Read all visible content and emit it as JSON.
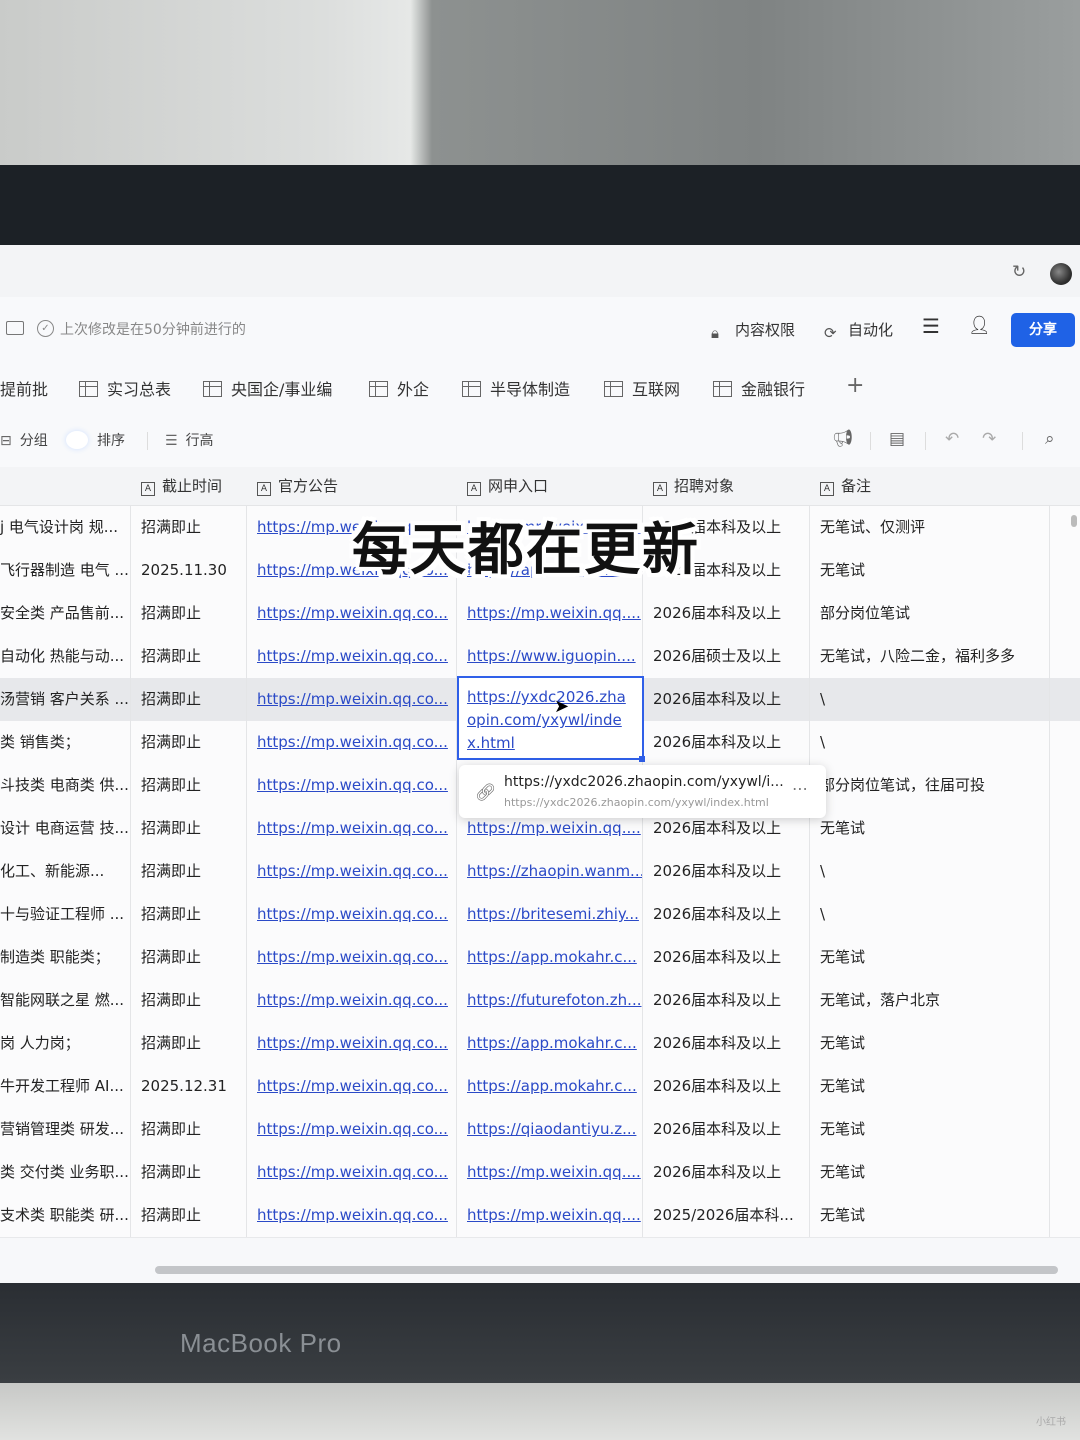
{
  "caption": "每天都在更新",
  "device_label": "MacBook Pro",
  "watermark": "小红书",
  "doc": {
    "status": "上次修改是在50分钟前进行的",
    "buttons": {
      "permissions": "内容权限",
      "automation": "自动化",
      "share": "分享"
    }
  },
  "tabs": [
    "提前批",
    "实习总表",
    "央国企/事业编",
    "外企",
    "半导体制造",
    "互联网",
    "金融银行"
  ],
  "toolbar": {
    "group": "分组",
    "sort": "排序",
    "row_height": "行高"
  },
  "columns": [
    "截止时间",
    "官方公告",
    "网申入口",
    "招聘对象",
    "备注"
  ],
  "rows": [
    {
      "c0": "j 电气设计岗 规...",
      "c1": "招满即止",
      "c2": "https://mp.weixin.qq.co...",
      "c3": "https://mp.weixin.qq....",
      "c4": "2026届本科及以上",
      "c5": "无笔试、仅测评"
    },
    {
      "c0": "飞行器制造 电气 ...",
      "c1": "2025.11.30",
      "c2": "https://mp.weixin.qq.co...",
      "c3": "https://app.mokahr.c...",
      "c4": "2026届本科及以上",
      "c5": "无笔试"
    },
    {
      "c0": "安全类 产品售前...",
      "c1": "招满即止",
      "c2": "https://mp.weixin.qq.co...",
      "c3": "https://mp.weixin.qq....",
      "c4": "2026届本科及以上",
      "c5": "部分岗位笔试"
    },
    {
      "c0": "自动化 热能与动...",
      "c1": "招满即止",
      "c2": "https://mp.weixin.qq.co...",
      "c3": "https://www.iguopin....",
      "c4": "2026届硕士及以上",
      "c5": "无笔试，八险二金，福利多多"
    },
    {
      "c0": "汤营销 客户关系 ...",
      "c1": "招满即止",
      "c2": "https://mp.weixin.qq.co...",
      "c3": "https://yxdc2026.zhaopin.com/yxywl/index.html",
      "c4": "2026届本科及以上",
      "c5": "\\"
    },
    {
      "c0": "类 销售类；",
      "c1": "招满即止",
      "c2": "https://mp.weixin.qq.co...",
      "c3": "",
      "c4": "2026届本科及以上",
      "c5": "\\"
    },
    {
      "c0": "斗技类 电商类 供...",
      "c1": "招满即止",
      "c2": "https://mp.weixin.qq.co...",
      "c3": "",
      "c4": "",
      "c5": "部分岗位笔试，往届可投"
    },
    {
      "c0": "设计 电商运营 技...",
      "c1": "招满即止",
      "c2": "https://mp.weixin.qq.co...",
      "c3": "https://mp.weixin.qq....",
      "c4": "2026届本科及以上",
      "c5": "无笔试"
    },
    {
      "c0": "化工、新能源...",
      "c1": "招满即止",
      "c2": "https://mp.weixin.qq.co...",
      "c3": "https://zhaopin.wanm...",
      "c4": "2026届本科及以上",
      "c5": "\\"
    },
    {
      "c0": "十与验证工程师 ...",
      "c1": "招满即止",
      "c2": "https://mp.weixin.qq.co...",
      "c3": "https://britesemi.zhiy...",
      "c4": "2026届本科及以上",
      "c5": "\\"
    },
    {
      "c0": "制造类 职能类；",
      "c1": "招满即止",
      "c2": "https://mp.weixin.qq.co...",
      "c3": "https://app.mokahr.c...",
      "c4": "2026届本科及以上",
      "c5": "无笔试"
    },
    {
      "c0": "智能网联之星 燃...",
      "c1": "招满即止",
      "c2": "https://mp.weixin.qq.co...",
      "c3": "https://futurefoton.zh...",
      "c4": "2026届本科及以上",
      "c5": "无笔试，落户北京"
    },
    {
      "c0": "岗 人力岗；",
      "c1": "招满即止",
      "c2": "https://mp.weixin.qq.co...",
      "c3": "https://app.mokahr.c...",
      "c4": "2026届本科及以上",
      "c5": "无笔试"
    },
    {
      "c0": "牛开发工程师 AI...",
      "c1": "2025.12.31",
      "c2": "https://mp.weixin.qq.co...",
      "c3": "https://app.mokahr.c...",
      "c4": "2026届本科及以上",
      "c5": "无笔试"
    },
    {
      "c0": "营销管理类 研发...",
      "c1": "招满即止",
      "c2": "https://mp.weixin.qq.co...",
      "c3": "https://qiaodantiyu.z...",
      "c4": "2026届本科及以上",
      "c5": "无笔试"
    },
    {
      "c0": "类 交付类 业务职...",
      "c1": "招满即止",
      "c2": "https://mp.weixin.qq.co...",
      "c3": "https://mp.weixin.qq....",
      "c4": "2026届本科及以上",
      "c5": "无笔试"
    },
    {
      "c0": "支术类 职能类 研...",
      "c1": "招满即止",
      "c2": "https://mp.weixin.qq.co...",
      "c3": "https://mp.weixin.qq....",
      "c4": "2025/2026届本科...",
      "c5": "无笔试"
    }
  ],
  "popup": {
    "url": "https://yxdc2026.zhaopin.com/yxywl/i...",
    "full_url": "https://yxdc2026.zhaopin.com/yxywl/index.html"
  }
}
